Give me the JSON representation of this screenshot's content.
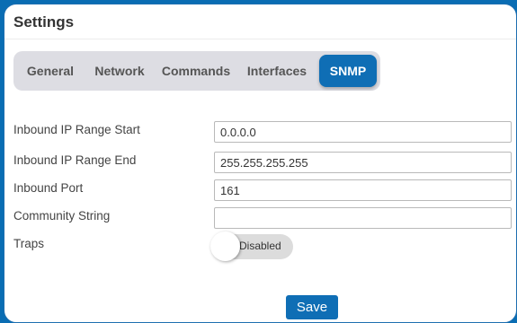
{
  "panel": {
    "title": "Settings"
  },
  "tabs": [
    {
      "label": "General",
      "active": false
    },
    {
      "label": "Network",
      "active": false
    },
    {
      "label": "Commands",
      "active": false
    },
    {
      "label": "Interfaces",
      "active": false
    },
    {
      "label": "SNMP",
      "active": true
    }
  ],
  "fields": {
    "inbound_ip_start": {
      "label": "Inbound IP Range Start",
      "value": "0.0.0.0"
    },
    "inbound_ip_end": {
      "label": "Inbound IP Range End",
      "value": "255.255.255.255"
    },
    "inbound_port": {
      "label": "Inbound Port",
      "value": "161"
    },
    "community_string": {
      "label": "Community String",
      "value": ""
    },
    "traps": {
      "label": "Traps",
      "state": "Disabled"
    }
  },
  "actions": {
    "save_label": "Save"
  },
  "colors": {
    "accent": "#0f6eb5",
    "frame": "#0a6db3",
    "tabbar_bg": "#dddde3",
    "toggle_off_bg": "#dcdcdc"
  }
}
